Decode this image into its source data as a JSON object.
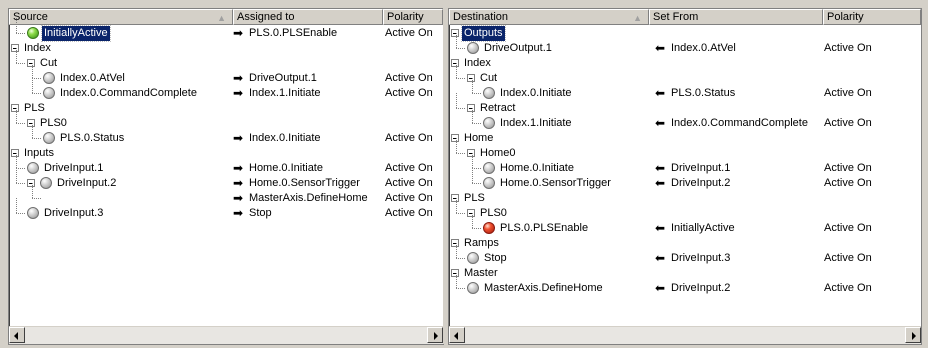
{
  "left": {
    "columns": [
      "Source",
      "Assigned to",
      "Polarity"
    ],
    "rows": [
      {
        "level": 1,
        "kind": "leaf",
        "led": "green",
        "label": "InitiallyActive",
        "selected": true,
        "assigned": "PLS.0.PLSEnable",
        "polarity": "Active On"
      },
      {
        "level": 0,
        "kind": "group",
        "label": "Index"
      },
      {
        "level": 1,
        "kind": "group",
        "label": "Cut"
      },
      {
        "level": 2,
        "kind": "leaf",
        "led": "grey",
        "label": "Index.0.AtVel",
        "assigned": "DriveOutput.1",
        "polarity": "Active On"
      },
      {
        "level": 2,
        "kind": "leaf",
        "led": "grey",
        "label": "Index.0.CommandComplete",
        "assigned": "Index.1.Initiate",
        "polarity": "Active On"
      },
      {
        "level": 0,
        "kind": "group",
        "label": "PLS"
      },
      {
        "level": 1,
        "kind": "group",
        "label": "PLS0"
      },
      {
        "level": 2,
        "kind": "leaf",
        "led": "grey",
        "label": "PLS.0.Status",
        "assigned": "Index.0.Initiate",
        "polarity": "Active On"
      },
      {
        "level": 0,
        "kind": "group",
        "label": "Inputs"
      },
      {
        "level": 1,
        "kind": "leaf",
        "led": "grey",
        "label": "DriveInput.1",
        "assigned": "Home.0.Initiate",
        "polarity": "Active On"
      },
      {
        "level": 1,
        "kind": "leaf",
        "led": "grey",
        "expander": true,
        "label": "DriveInput.2",
        "assigned": "Home.0.SensorTrigger",
        "polarity": "Active On"
      },
      {
        "level": 2,
        "kind": "stub",
        "label": "",
        "assigned": "MasterAxis.DefineHome",
        "polarity": "Active On"
      },
      {
        "level": 1,
        "kind": "leaf",
        "led": "grey",
        "label": "DriveInput.3",
        "assigned": "Stop",
        "polarity": "Active On"
      }
    ]
  },
  "right": {
    "columns": [
      "Destination",
      "Set From",
      "Polarity"
    ],
    "rows": [
      {
        "level": 0,
        "kind": "group",
        "label": "Outputs",
        "selected": true
      },
      {
        "level": 1,
        "kind": "leaf",
        "led": "grey",
        "label": "DriveOutput.1",
        "from": "Index.0.AtVel",
        "polarity": "Active On"
      },
      {
        "level": 0,
        "kind": "group",
        "label": "Index"
      },
      {
        "level": 1,
        "kind": "group",
        "label": "Cut"
      },
      {
        "level": 2,
        "kind": "leaf",
        "led": "grey",
        "label": "Index.0.Initiate",
        "from": "PLS.0.Status",
        "polarity": "Active On"
      },
      {
        "level": 1,
        "kind": "group",
        "label": "Retract"
      },
      {
        "level": 2,
        "kind": "leaf",
        "led": "grey",
        "label": "Index.1.Initiate",
        "from": "Index.0.CommandComplete",
        "polarity": "Active On"
      },
      {
        "level": 0,
        "kind": "group",
        "label": "Home"
      },
      {
        "level": 1,
        "kind": "group",
        "label": "Home0"
      },
      {
        "level": 2,
        "kind": "leaf",
        "led": "grey",
        "label": "Home.0.Initiate",
        "from": "DriveInput.1",
        "polarity": "Active On"
      },
      {
        "level": 2,
        "kind": "leaf",
        "led": "grey",
        "label": "Home.0.SensorTrigger",
        "from": "DriveInput.2",
        "polarity": "Active On"
      },
      {
        "level": 0,
        "kind": "group",
        "label": "PLS"
      },
      {
        "level": 1,
        "kind": "group",
        "label": "PLS0"
      },
      {
        "level": 2,
        "kind": "leaf",
        "led": "red",
        "label": "PLS.0.PLSEnable",
        "from": "InitiallyActive",
        "polarity": "Active On"
      },
      {
        "level": 0,
        "kind": "group",
        "label": "Ramps"
      },
      {
        "level": 1,
        "kind": "leaf",
        "led": "grey",
        "label": "Stop",
        "from": "DriveInput.3",
        "polarity": "Active On"
      },
      {
        "level": 0,
        "kind": "group",
        "label": "Master"
      },
      {
        "level": 1,
        "kind": "leaf",
        "led": "grey",
        "label": "MasterAxis.DefineHome",
        "from": "DriveInput.2",
        "polarity": "Active On"
      }
    ]
  },
  "icons": {
    "assigned_arrow": "arrow-right-icon",
    "from_arrow": "arrow-left-icon",
    "sort": "sort-indicator-icon"
  },
  "colors": {
    "selection": "#0a246a",
    "led_on": "#2f8a10",
    "led_fault": "#d03018",
    "led_off": "#9a9a9a"
  }
}
